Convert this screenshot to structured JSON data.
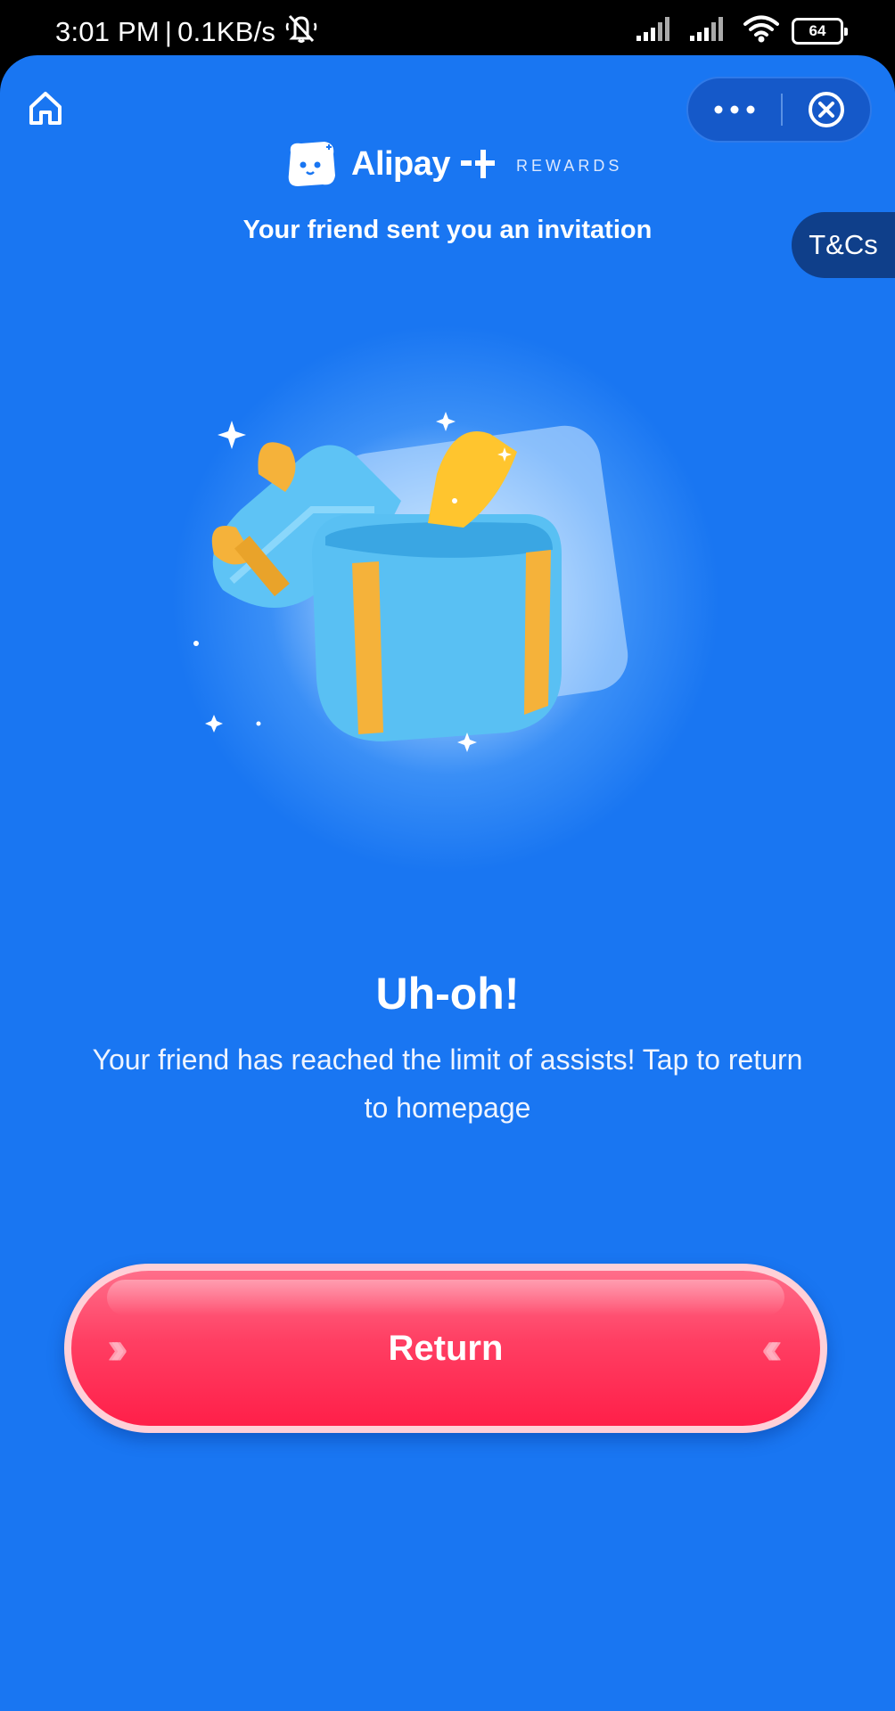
{
  "status_bar": {
    "time": "3:01 PM",
    "separator": "|",
    "speed": "0.1KB/s",
    "battery": "64"
  },
  "header": {
    "brand_name": "Alipay",
    "brand_sub": "REWARDS"
  },
  "main": {
    "invite_text": "Your friend sent you an invitation",
    "tncs_label": "T&Cs",
    "title": "Uh-oh!",
    "message": "Your friend has reached the limit of assists! Tap to return to homepage",
    "button_label": "Return"
  },
  "colors": {
    "background": "#1976f2",
    "button": "#ff2f55",
    "tncs": "#0f3f8a"
  },
  "icons": [
    "home-icon",
    "more-icon",
    "close-circle-icon",
    "gift-box-illustration",
    "mute-icon",
    "signal-icon",
    "wifi-icon",
    "battery-icon"
  ]
}
